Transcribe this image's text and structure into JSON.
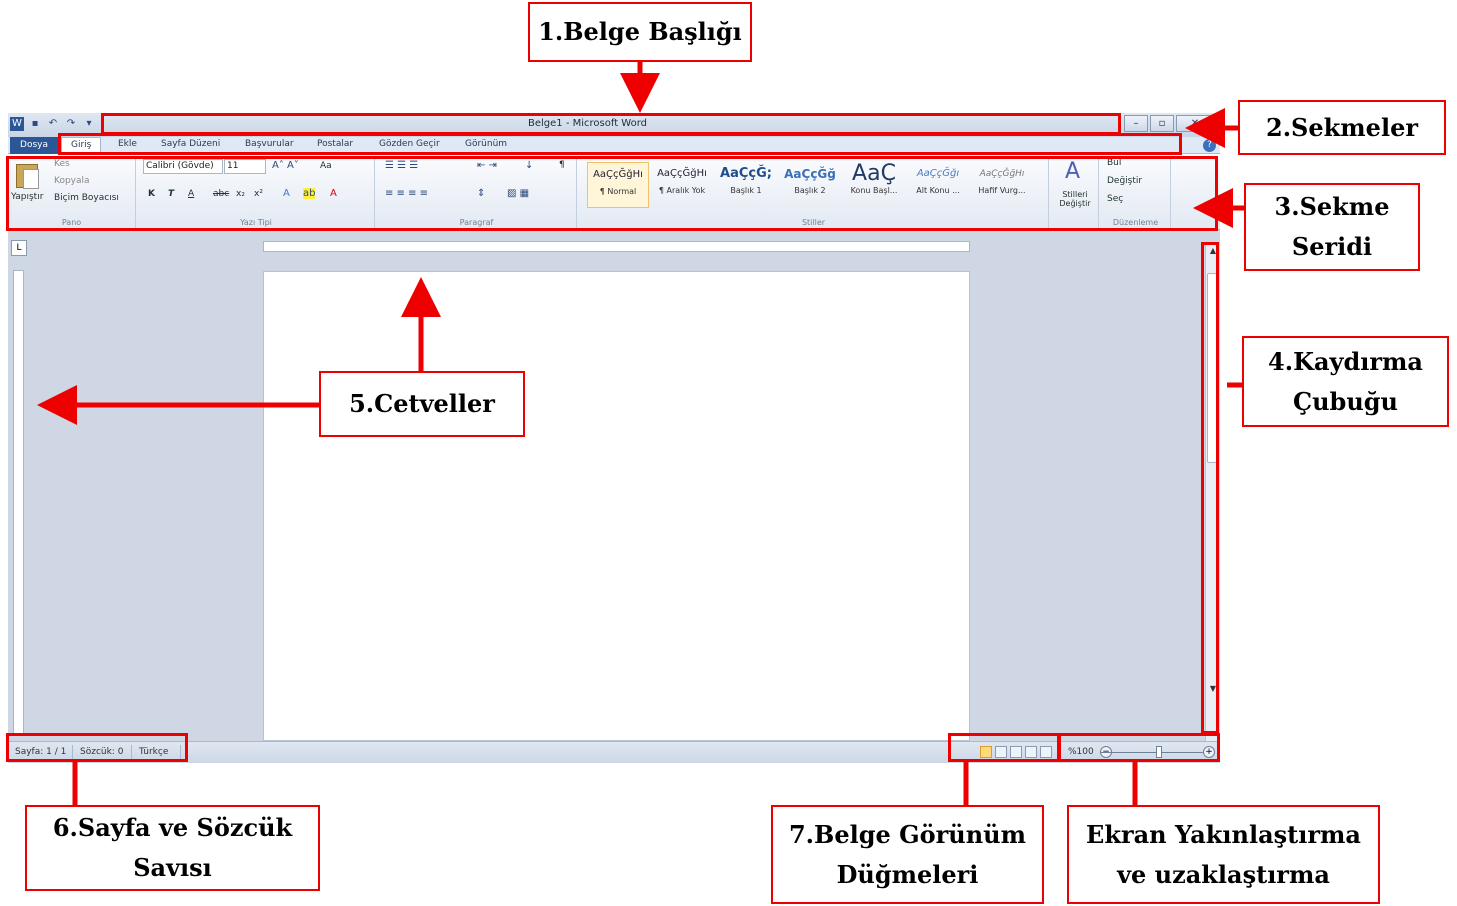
{
  "word": {
    "title": "Belge1 - Microsoft Word",
    "qat_icons": [
      "word-app-icon",
      "save-icon",
      "undo-icon",
      "redo-icon",
      "customize-icon"
    ],
    "tabs": [
      "Dosya",
      "Giriş",
      "Ekle",
      "Sayfa Düzeni",
      "Başvurular",
      "Postalar",
      "Gözden Geçir",
      "Görünüm"
    ],
    "clipboard": {
      "paste": "Yapıştır",
      "cut": "Kes",
      "copy": "Kopyala",
      "format_painter": "Biçim Boyacısı",
      "group": "Pano"
    },
    "font": {
      "name": "Calibri (Gövde)",
      "size": "11",
      "bold": "K",
      "italic": "T",
      "underline": "A",
      "strike": "abc",
      "subscript": "x₂",
      "superscript": "x²",
      "case": "Aa",
      "group": "Yazı Tipi"
    },
    "paragraph": {
      "group": "Paragraf",
      "pilcrow": "¶"
    },
    "styles": [
      {
        "sample": "AaÇçĞğHı",
        "name": "¶ Normal"
      },
      {
        "sample": "AaÇçĞğHı",
        "name": "¶ Aralık Yok"
      },
      {
        "sample": "AaÇçĞ;",
        "name": "Başlık 1"
      },
      {
        "sample": "AaÇçĞğ",
        "name": "Başlık 2"
      },
      {
        "sample": "AaÇ",
        "name": "Konu Başl..."
      },
      {
        "sample": "AaÇçĞğı",
        "name": "Alt Konu ..."
      },
      {
        "sample": "AaÇçĞğHı",
        "name": "Hafif Vurg..."
      }
    ],
    "styles_group": "Stiller",
    "change_styles": "Stilleri Değiştir",
    "editing": {
      "find": "Bul",
      "replace": "Değiştir",
      "select": "Seç",
      "group": "Düzenleme"
    },
    "ruler_tab": "L",
    "status": {
      "page": "Sayfa: 1 / 1",
      "words": "Sözcük: 0",
      "language": "Türkçe",
      "zoom": "%100"
    }
  },
  "labels": {
    "title": "1.Belge Başlığı",
    "tabs": "2.Sekmeler",
    "ribbon": "3.Sekme Seridi",
    "scrollbar": "4.Kaydırma Çubuğu",
    "rulers": "5.Cetveller",
    "page_count": "6.Sayfa ve Sözcük Savısı",
    "view_buttons": "7.Belge Görünüm Düğmeleri",
    "zoom": "Ekran Yakınlaştırma ve uzaklaştırma"
  },
  "colors": {
    "annotation": "#e00000",
    "file_tab": "#2b5797"
  }
}
